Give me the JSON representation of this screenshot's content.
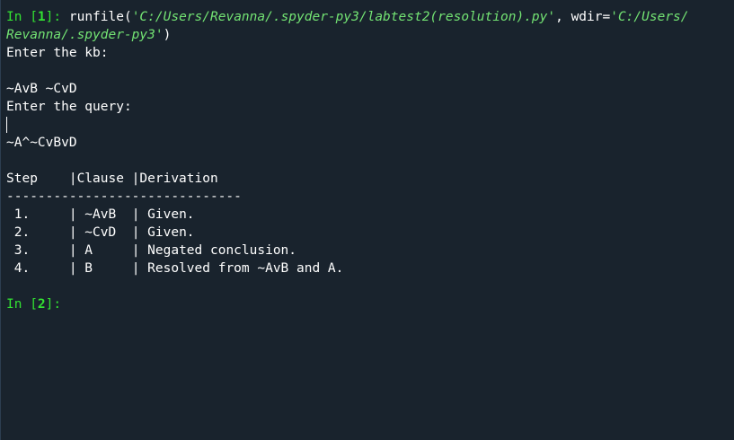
{
  "console": {
    "in1": {
      "prompt_prefix": "In [",
      "prompt_number": "1",
      "prompt_suffix": "]:",
      "command_fn": "runfile(",
      "command_path_part1": "'C:/Users/Revanna/.spyder-py3/labtest2(resolution).py'",
      "command_sep": ", wdir=",
      "command_wdir_part1": "'C:/Users/",
      "command_wdir_part2": "Revanna/.spyder-py3'",
      "command_close": ")"
    },
    "kb_prompt": "Enter the kb:",
    "kb_input": "~AvB ~CvD",
    "query_prompt": "Enter the query:",
    "query_input": "~A^~CvBvD",
    "table": {
      "header": "Step    |Clause |Derivation",
      "separator": "------------------------------",
      "rows": [
        {
          "step": " 1.     ",
          "clause": "| ~AvB  ",
          "derivation": "| Given."
        },
        {
          "step": " 2.     ",
          "clause": "| ~CvD  ",
          "derivation": "| Given."
        },
        {
          "step": " 3.     ",
          "clause": "| A     ",
          "derivation": "| Negated conclusion."
        },
        {
          "step": " 4.     ",
          "clause": "| B     ",
          "derivation": "| Resolved from ~AvB and A."
        }
      ]
    },
    "in2": {
      "prompt_prefix": "In [",
      "prompt_number": "2",
      "prompt_suffix": "]:"
    }
  },
  "colors": {
    "background": "#19232d",
    "prompt": "#33e332",
    "string": "#73e373",
    "text": "#ffffff"
  }
}
